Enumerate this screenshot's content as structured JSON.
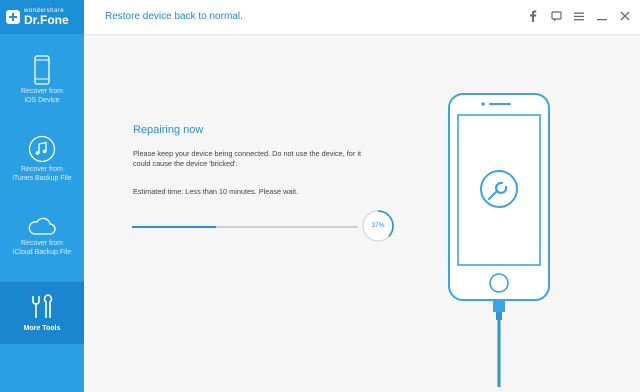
{
  "app": {
    "brand_small": "wondershare",
    "brand_name": "Dr.Fone"
  },
  "header": {
    "title": "Restore device back to normal.",
    "icons": [
      "facebook-icon",
      "feedback-icon",
      "menu-icon",
      "minimize-icon",
      "close-icon"
    ]
  },
  "sidebar": {
    "items": [
      {
        "label_line1": "Recover from",
        "label_line2": "iOS Device",
        "icon": "phone-icon",
        "active": false
      },
      {
        "label_line1": "Recover from",
        "label_line2": "iTunes Backup File",
        "icon": "music-note-icon",
        "active": false
      },
      {
        "label_line1": "Recover from",
        "label_line2": "iCloud Backup File",
        "icon": "cloud-icon",
        "active": false
      },
      {
        "label_line1": "More Tools",
        "label_line2": "",
        "icon": "tools-icon",
        "active": true
      }
    ]
  },
  "main": {
    "title": "Repairing now",
    "description": "Please keep your device being connected. Do not use the device, for it could cause the device  'bricked'.",
    "estimated_time": "Estimated time: Less than 10 minutes. Please wait.",
    "progress_percent": 37,
    "progress_label": "37%"
  },
  "colors": {
    "sidebar": "#2a9fe3",
    "accent": "#2d8ed6",
    "phone_outline": "#3aa5e6"
  }
}
